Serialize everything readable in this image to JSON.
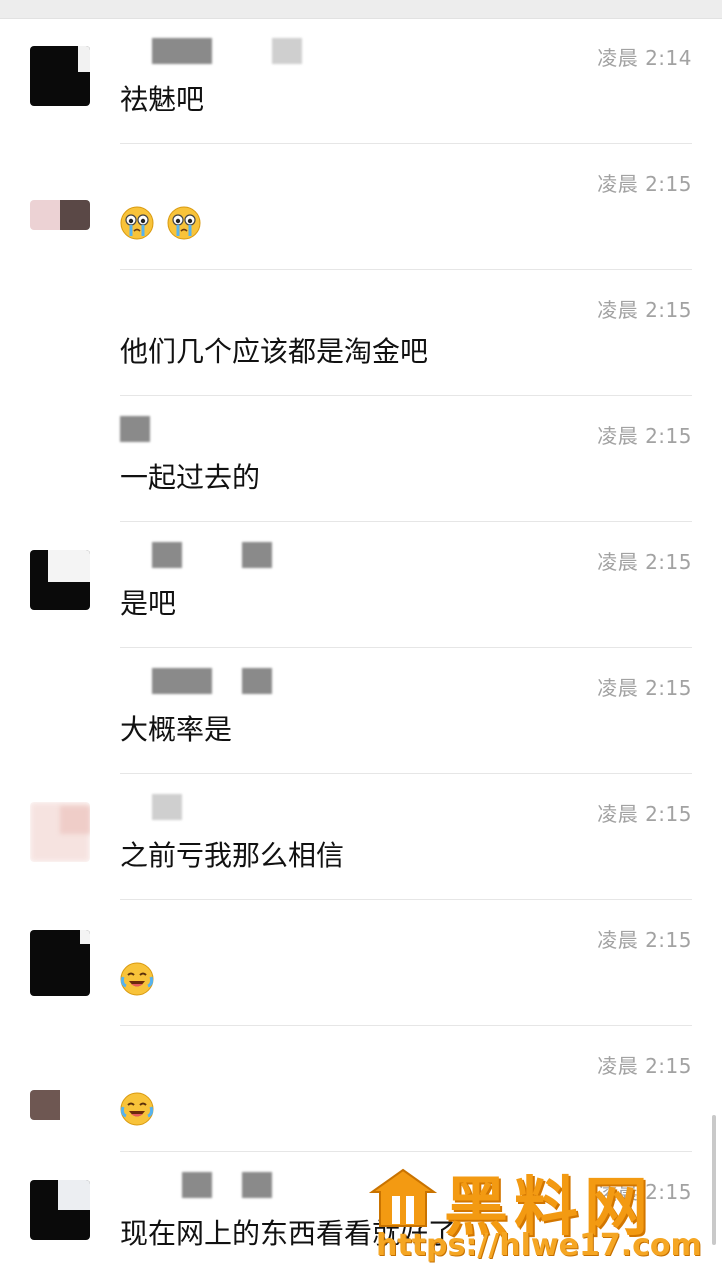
{
  "messages": [
    {
      "time": "凌晨 2:14",
      "text": "祛魅吧",
      "emoji_count": 0
    },
    {
      "time": "凌晨 2:15",
      "text": "",
      "emoji": "crying-emoji",
      "emoji_count": 2
    },
    {
      "time": "凌晨 2:15",
      "text": "他们几个应该都是淘金吧",
      "emoji_count": 0
    },
    {
      "time": "凌晨 2:15",
      "text": "一起过去的",
      "emoji_count": 0
    },
    {
      "time": "凌晨 2:15",
      "text": "是吧",
      "emoji_count": 0
    },
    {
      "time": "凌晨 2:15",
      "text": "大概率是",
      "emoji_count": 0
    },
    {
      "time": "凌晨 2:15",
      "text": "之前亏我那么相信",
      "emoji_count": 0
    },
    {
      "time": "凌晨 2:15",
      "text": "",
      "emoji": "laugh-cry-emoji",
      "emoji_count": 1
    },
    {
      "time": "凌晨 2:15",
      "text": "",
      "emoji": "laugh-cry-emoji",
      "emoji_count": 1
    },
    {
      "time": "凌晨 2:15",
      "text": "现在网上的东西看看就好了",
      "emoji_count": 0
    }
  ],
  "watermark": {
    "title": "黑料网",
    "url": "https://hlwe17.com"
  },
  "colors": {
    "accent": "#f39a12",
    "time": "#a2a2a2",
    "divider": "#e6e6e6"
  }
}
